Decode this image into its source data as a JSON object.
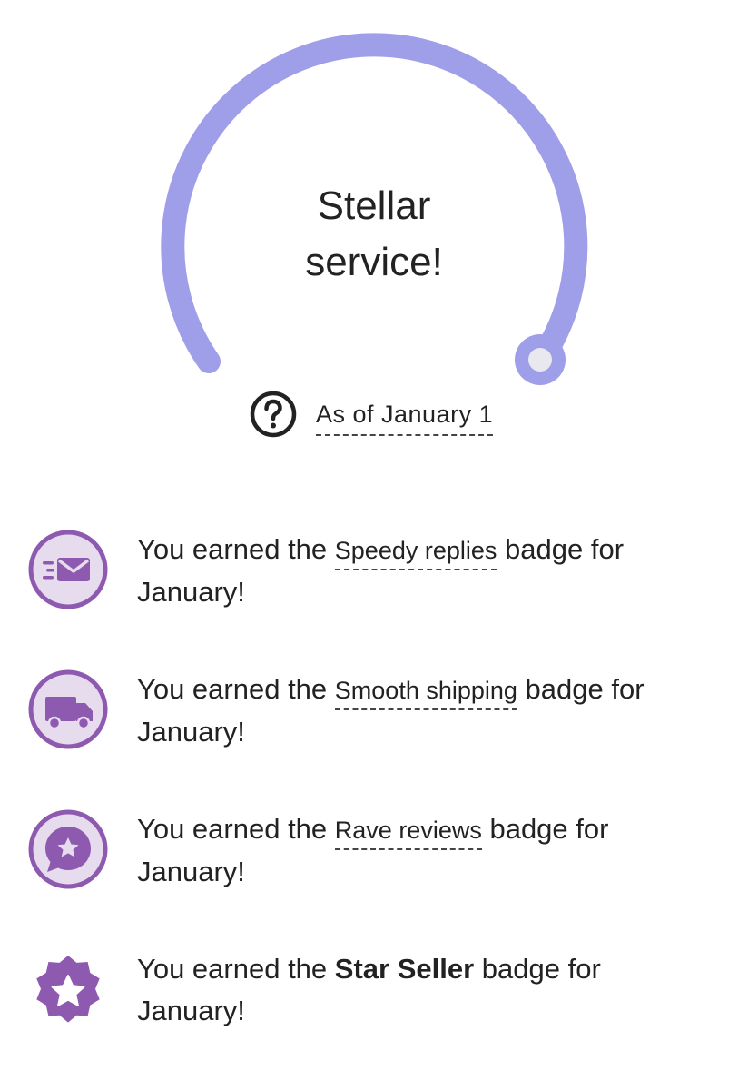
{
  "gauge": {
    "title_line1": "Stellar",
    "title_line2": "service!",
    "level": 1.0,
    "color": "#9f9ee9",
    "knob_fill": "#e9e8ee"
  },
  "as_of": {
    "icon": "question-circle-icon",
    "text": "As of January 1"
  },
  "badges": [
    {
      "icon": "envelope-speed-icon",
      "prefix": "You earned the ",
      "name": "Speedy replies",
      "suffix": " badge for January!"
    },
    {
      "icon": "truck-icon",
      "prefix": "You earned the ",
      "name": "Smooth shipping",
      "suffix": " badge for January!"
    },
    {
      "icon": "star-chat-bubble-icon",
      "prefix": "You earned the ",
      "name": "Rave reviews",
      "suffix": " badge for January!"
    },
    {
      "icon": "star-seller-badge-icon",
      "prefix": "You earned the ",
      "name": "Star Seller",
      "suffix": " badge for January!"
    }
  ],
  "colors": {
    "badge_purple": "#8e5ab0",
    "badge_light": "#e6dcee",
    "text": "#222222",
    "gauge": "#9f9ee9"
  }
}
